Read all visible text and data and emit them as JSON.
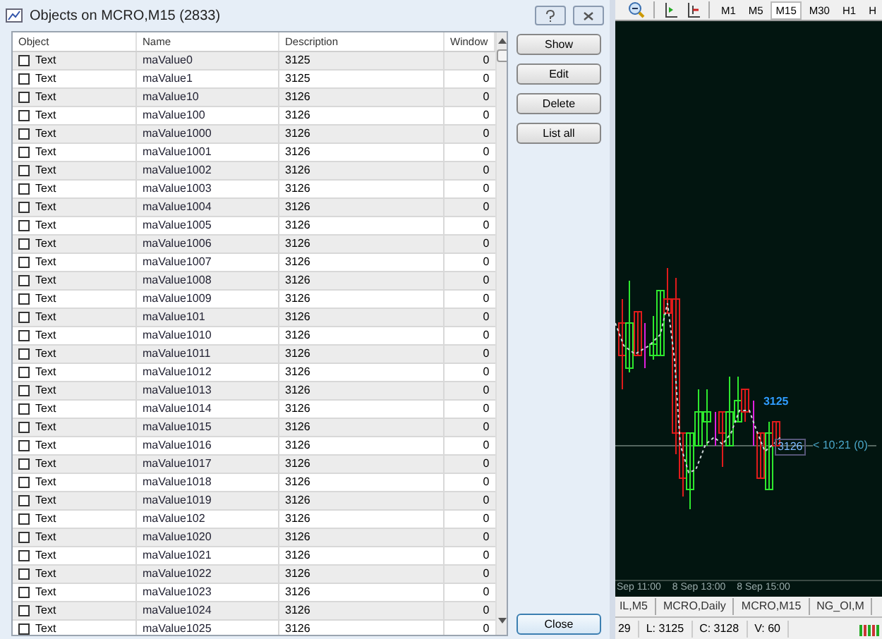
{
  "dialog": {
    "title": "Objects on MCRO,M15 (2833)"
  },
  "table": {
    "columns": [
      "Object",
      "Name",
      "Description",
      "Window"
    ],
    "rows": [
      {
        "checked": false,
        "object": "Text",
        "name": "maValue0",
        "description": "3125",
        "window": "0"
      },
      {
        "checked": false,
        "object": "Text",
        "name": "maValue1",
        "description": "3125",
        "window": "0"
      },
      {
        "checked": false,
        "object": "Text",
        "name": "maValue10",
        "description": "3126",
        "window": "0"
      },
      {
        "checked": false,
        "object": "Text",
        "name": "maValue100",
        "description": "3126",
        "window": "0"
      },
      {
        "checked": false,
        "object": "Text",
        "name": "maValue1000",
        "description": "3126",
        "window": "0"
      },
      {
        "checked": false,
        "object": "Text",
        "name": "maValue1001",
        "description": "3126",
        "window": "0"
      },
      {
        "checked": false,
        "object": "Text",
        "name": "maValue1002",
        "description": "3126",
        "window": "0"
      },
      {
        "checked": false,
        "object": "Text",
        "name": "maValue1003",
        "description": "3126",
        "window": "0"
      },
      {
        "checked": false,
        "object": "Text",
        "name": "maValue1004",
        "description": "3126",
        "window": "0"
      },
      {
        "checked": false,
        "object": "Text",
        "name": "maValue1005",
        "description": "3126",
        "window": "0"
      },
      {
        "checked": false,
        "object": "Text",
        "name": "maValue1006",
        "description": "3126",
        "window": "0"
      },
      {
        "checked": false,
        "object": "Text",
        "name": "maValue1007",
        "description": "3126",
        "window": "0"
      },
      {
        "checked": false,
        "object": "Text",
        "name": "maValue1008",
        "description": "3126",
        "window": "0"
      },
      {
        "checked": false,
        "object": "Text",
        "name": "maValue1009",
        "description": "3126",
        "window": "0"
      },
      {
        "checked": false,
        "object": "Text",
        "name": "maValue101",
        "description": "3126",
        "window": "0"
      },
      {
        "checked": false,
        "object": "Text",
        "name": "maValue1010",
        "description": "3126",
        "window": "0"
      },
      {
        "checked": false,
        "object": "Text",
        "name": "maValue1011",
        "description": "3126",
        "window": "0"
      },
      {
        "checked": false,
        "object": "Text",
        "name": "maValue1012",
        "description": "3126",
        "window": "0"
      },
      {
        "checked": false,
        "object": "Text",
        "name": "maValue1013",
        "description": "3126",
        "window": "0"
      },
      {
        "checked": false,
        "object": "Text",
        "name": "maValue1014",
        "description": "3126",
        "window": "0"
      },
      {
        "checked": false,
        "object": "Text",
        "name": "maValue1015",
        "description": "3126",
        "window": "0"
      },
      {
        "checked": false,
        "object": "Text",
        "name": "maValue1016",
        "description": "3126",
        "window": "0"
      },
      {
        "checked": false,
        "object": "Text",
        "name": "maValue1017",
        "description": "3126",
        "window": "0"
      },
      {
        "checked": false,
        "object": "Text",
        "name": "maValue1018",
        "description": "3126",
        "window": "0"
      },
      {
        "checked": false,
        "object": "Text",
        "name": "maValue1019",
        "description": "3126",
        "window": "0"
      },
      {
        "checked": false,
        "object": "Text",
        "name": "maValue102",
        "description": "3126",
        "window": "0"
      },
      {
        "checked": false,
        "object": "Text",
        "name": "maValue1020",
        "description": "3126",
        "window": "0"
      },
      {
        "checked": false,
        "object": "Text",
        "name": "maValue1021",
        "description": "3126",
        "window": "0"
      },
      {
        "checked": false,
        "object": "Text",
        "name": "maValue1022",
        "description": "3126",
        "window": "0"
      },
      {
        "checked": false,
        "object": "Text",
        "name": "maValue1023",
        "description": "3126",
        "window": "0"
      },
      {
        "checked": false,
        "object": "Text",
        "name": "maValue1024",
        "description": "3126",
        "window": "0"
      },
      {
        "checked": false,
        "object": "Text",
        "name": "maValue1025",
        "description": "3126",
        "window": "0"
      }
    ]
  },
  "buttons": [
    "Show",
    "Edit",
    "Delete",
    "List all"
  ],
  "close_button": "Close",
  "toolbar": {
    "timeframes": [
      {
        "label": "M1",
        "selected": false
      },
      {
        "label": "M5",
        "selected": false
      },
      {
        "label": "M15",
        "selected": true
      },
      {
        "label": "M30",
        "selected": false
      },
      {
        "label": "H1",
        "selected": false
      },
      {
        "label": "H",
        "selected": false
      }
    ]
  },
  "chart": {
    "price_label": "3125",
    "price_box": "3126",
    "timer": "< 10:21 (0)",
    "time_labels": [
      "Sep 11:00",
      "8 Sep 13:00",
      "8 Sep 15:00"
    ]
  },
  "chart_tabs": [
    "IL,M5",
    "MCRO,Daily",
    "MCRO,M15",
    "NG_OI,M"
  ],
  "status_bar": [
    "29",
    "L: 3125",
    "C: 3128",
    "V: 60"
  ]
}
